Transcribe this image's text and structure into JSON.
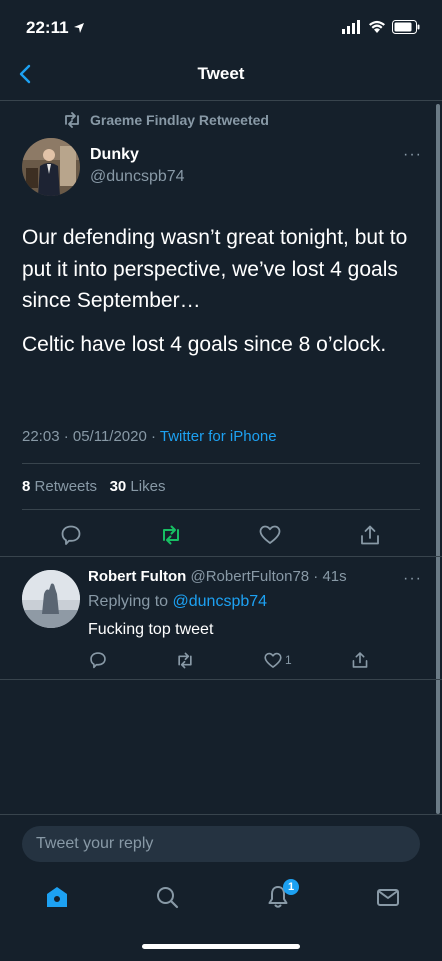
{
  "status_bar": {
    "time": "22:11"
  },
  "header": {
    "title": "Tweet"
  },
  "retweet_notice": "Graeme Findlay Retweeted",
  "tweet": {
    "name": "Dunky",
    "handle": "@duncspb74",
    "text_1": "Our defending wasn’t great tonight, but to put it into perspective, we’ve lost 4 goals since September…",
    "text_2": "Celtic have lost 4 goals since 8 o’clock.",
    "time": "22:03 · 05/11/2020 · ",
    "source": "Twitter for iPhone",
    "retweets_count": "8",
    "retweets_label": "Retweets",
    "likes_count": "30",
    "likes_label": "Likes",
    "more": "···"
  },
  "reply": {
    "name": "Robert Fulton",
    "handle_time": "@RobertFulton78 · 41s",
    "replying_to_label": "Replying to ",
    "replying_to_handle": "@duncspb74",
    "text": "Fucking top tweet",
    "like_count": "1",
    "more": "···"
  },
  "composer": {
    "placeholder": "Tweet your reply"
  },
  "notifications_badge": "1",
  "colors": {
    "background": "#15202b",
    "accent": "#1da1f2",
    "retweet_green": "#17bf63",
    "muted": "#8899a6",
    "divider": "#38444d"
  }
}
